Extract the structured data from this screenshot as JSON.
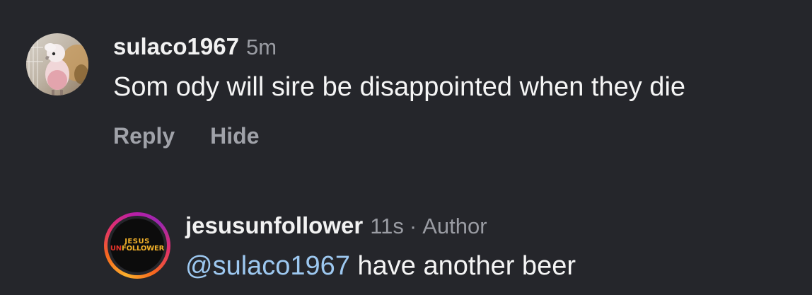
{
  "comments": [
    {
      "username": "sulaco1967",
      "time": "5m",
      "text": "Som ody will sire be disappointed when they die",
      "actions": {
        "reply": "Reply",
        "hide": "Hide"
      }
    }
  ],
  "reply": {
    "username": "jesusunfollower",
    "time": "11s",
    "separator": "·",
    "author_tag": "Author",
    "mention": "@sulaco1967",
    "text": "have another beer",
    "avatar_logo": {
      "line1": "JESUS",
      "line2_prefix": "UN",
      "line2_rest": "FOLLOWER"
    }
  },
  "colors": {
    "background": "#25262b",
    "mention": "#9dc8f0",
    "muted": "#9a9ca3"
  }
}
